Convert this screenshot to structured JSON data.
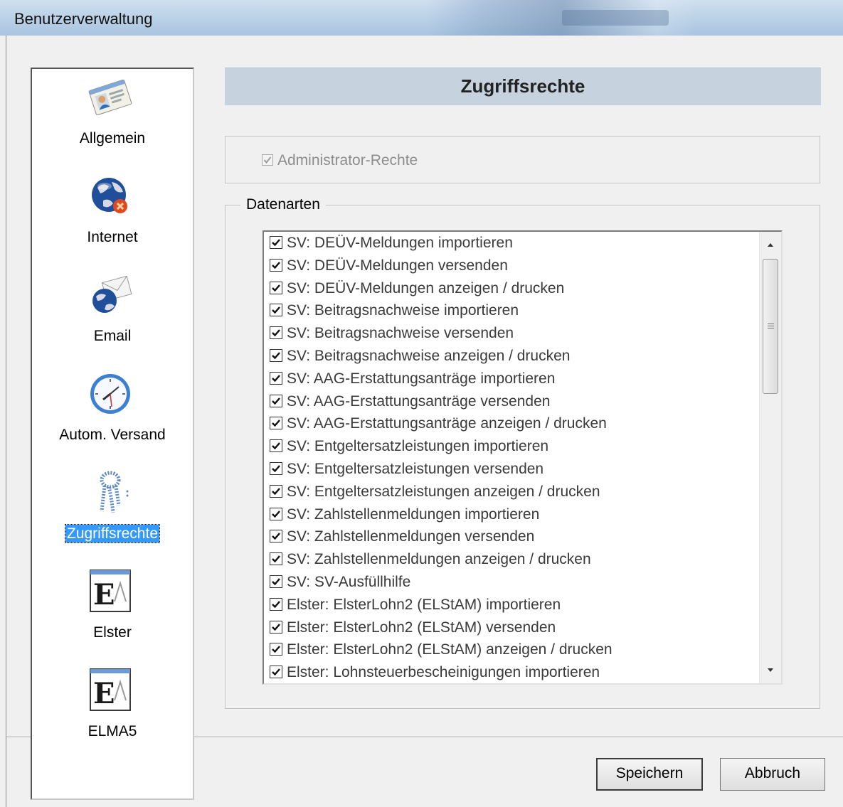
{
  "window": {
    "title": "Benutzerverwaltung"
  },
  "sidebar": {
    "items": [
      {
        "label": "Allgemein",
        "icon": "id-card-icon"
      },
      {
        "label": "Internet",
        "icon": "globe-icon"
      },
      {
        "label": "Email",
        "icon": "envelope-globe-icon"
      },
      {
        "label": "Autom. Versand",
        "icon": "clock-icon"
      },
      {
        "label": "Zugriffsrechte",
        "icon": "keys-icon",
        "selected": true
      },
      {
        "label": "Elster",
        "icon": "elster-icon"
      },
      {
        "label": "ELMA5",
        "icon": "elster-icon"
      }
    ]
  },
  "header": {
    "title": "Zugriffsrechte"
  },
  "admin": {
    "label": "Administrator-Rechte",
    "checked": true,
    "enabled": false
  },
  "datenarten": {
    "label": "Datenarten",
    "items": [
      "SV: DEÜV-Meldungen importieren",
      "SV: DEÜV-Meldungen versenden",
      "SV: DEÜV-Meldungen anzeigen / drucken",
      "SV: Beitragsnachweise importieren",
      "SV: Beitragsnachweise versenden",
      "SV: Beitragsnachweise anzeigen / drucken",
      "SV: AAG-Erstattungsanträge importieren",
      "SV: AAG-Erstattungsanträge versenden",
      "SV: AAG-Erstattungsanträge anzeigen / drucken",
      "SV: Entgeltersatzleistungen importieren",
      "SV: Entgeltersatzleistungen versenden",
      "SV: Entgeltersatzleistungen anzeigen / drucken",
      "SV: Zahlstellenmeldungen importieren",
      "SV: Zahlstellenmeldungen versenden",
      "SV: Zahlstellenmeldungen anzeigen / drucken",
      "SV: SV-Ausfüllhilfe",
      "Elster: ElsterLohn2 (ELStAM) importieren",
      "Elster: ElsterLohn2 (ELStAM) versenden",
      "Elster: ElsterLohn2 (ELStAM) anzeigen / drucken",
      "Elster: Lohnsteuerbescheinigungen importieren"
    ]
  },
  "buttons": {
    "save": "Speichern",
    "cancel": "Abbruch"
  },
  "colors": {
    "header_bg": "#c6d3de",
    "selection": "#3399ff",
    "window_bg": "#f0f0f0"
  }
}
